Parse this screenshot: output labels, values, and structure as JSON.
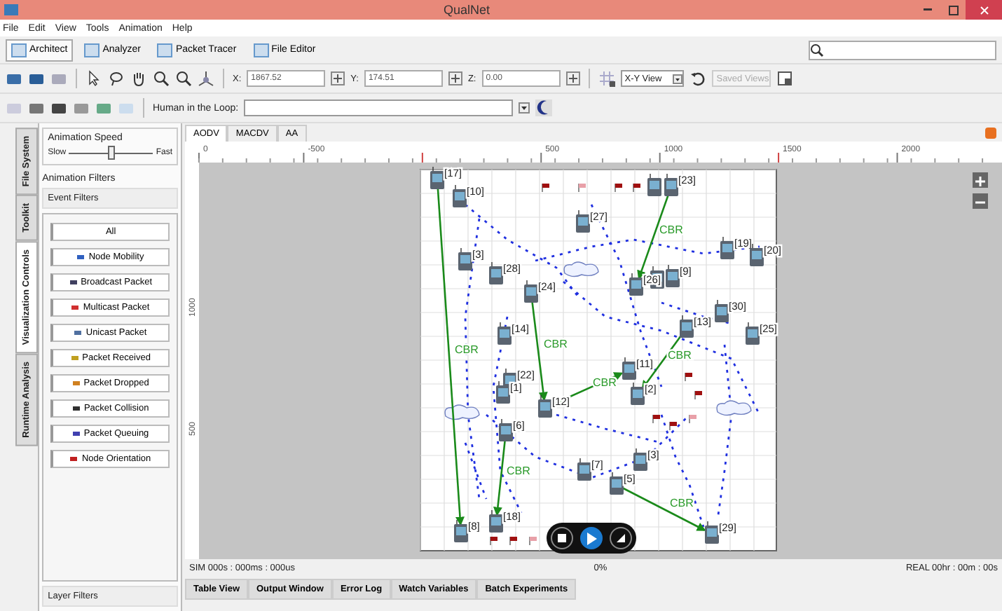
{
  "window": {
    "title": "QualNet"
  },
  "menu": [
    "File",
    "Edit",
    "View",
    "Tools",
    "Animation",
    "Help"
  ],
  "perspectives": [
    {
      "label": "Architect",
      "selected": true
    },
    {
      "label": "Analyzer",
      "selected": false
    },
    {
      "label": "Packet Tracer",
      "selected": false
    },
    {
      "label": "File Editor",
      "selected": false
    }
  ],
  "coordinates": [
    {
      "label": "X:",
      "value": "1867.52"
    },
    {
      "label": "Y:",
      "value": "174.51"
    },
    {
      "label": "Z:",
      "value": "0.00"
    }
  ],
  "view_select": {
    "value": "X-Y View"
  },
  "saved_views": {
    "value": "Saved Views",
    "disabled": true
  },
  "human_in_the_loop": {
    "label": "Human in the Loop:"
  },
  "side_tabs": [
    {
      "label": "File System",
      "selected": false
    },
    {
      "label": "Toolkit",
      "selected": false
    },
    {
      "label": "Visualization Controls",
      "selected": true
    },
    {
      "label": "Runtime Analysis",
      "selected": false
    }
  ],
  "animation_speed": {
    "title": "Animation Speed",
    "min_label": "Slow",
    "max_label": "Fast",
    "level": 0.5
  },
  "animation_filters": {
    "title": "Animation Filters",
    "event_filters": "Event Filters",
    "layer_filters": "Layer Filters",
    "items": [
      {
        "label": "All",
        "kind": "all"
      },
      {
        "label": "Node Mobility",
        "kind": "event"
      },
      {
        "label": "Broadcast Packet",
        "kind": "event"
      },
      {
        "label": "Multicast Packet",
        "kind": "event"
      },
      {
        "label": "Unicast Packet",
        "kind": "event"
      },
      {
        "label": "Packet Received",
        "kind": "event"
      },
      {
        "label": "Packet Dropped",
        "kind": "event"
      },
      {
        "label": "Packet Collision",
        "kind": "event"
      },
      {
        "label": "Packet Queuing",
        "kind": "event"
      },
      {
        "label": "Node Orientation",
        "kind": "event"
      }
    ]
  },
  "scenario_tabs": [
    {
      "label": "AODV",
      "selected": true
    },
    {
      "label": "MACDV",
      "selected": false
    },
    {
      "label": "AA",
      "selected": false
    }
  ],
  "ruler": {
    "x_ticks": [
      "0",
      "-500",
      "500",
      "1000",
      "1500",
      "2000"
    ],
    "y_ticks": [
      "1000",
      "500"
    ]
  },
  "nodes": [
    {
      "label": "[17]"
    },
    {
      "label": "[10]"
    },
    {
      "label": "[23]"
    },
    {
      "label": "[27]"
    },
    {
      "label": "[3]"
    },
    {
      "label": "[28]"
    },
    {
      "label": "[24]"
    },
    {
      "label": "[19]"
    },
    {
      "label": "[20]"
    },
    {
      "label": "[26]"
    },
    {
      "label": "[9]"
    },
    {
      "label": "[30]"
    },
    {
      "label": "[13]"
    },
    {
      "label": "[25]"
    },
    {
      "label": "[14]"
    },
    {
      "label": "[22]"
    },
    {
      "label": "[1]"
    },
    {
      "label": "[12]"
    },
    {
      "label": "[11]"
    },
    {
      "label": "[2]"
    },
    {
      "label": "[6]"
    },
    {
      "label": "[3]"
    },
    {
      "label": "[7]"
    },
    {
      "label": "[5]"
    },
    {
      "label": "[8]"
    },
    {
      "label": "[18]"
    },
    {
      "label": "[29]"
    }
  ],
  "links": [
    {
      "label": "CBR"
    },
    {
      "label": "CBR"
    },
    {
      "label": "CBR"
    },
    {
      "label": "CBR"
    },
    {
      "label": "CBR"
    },
    {
      "label": "CBR"
    },
    {
      "label": "CBR"
    }
  ],
  "status": {
    "sim_time": "SIM 000s : 000ms : 000us",
    "progress": "0%",
    "real_time": "REAL 00hr : 00m : 00s"
  },
  "bottom_tabs": [
    "Table View",
    "Output Window",
    "Error Log",
    "Watch Variables",
    "Batch Experiments"
  ]
}
